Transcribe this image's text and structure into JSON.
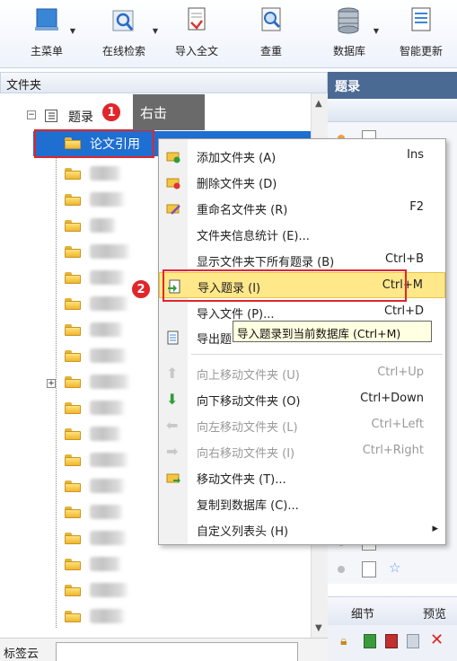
{
  "toolbar": {
    "items": [
      {
        "label": "主菜单",
        "icon": "main-menu-icon"
      },
      {
        "label": "在线检索",
        "icon": "online-search-icon"
      },
      {
        "label": "导入全文",
        "icon": "import-fulltext-icon"
      },
      {
        "label": "查重",
        "icon": "duplicate-check-icon"
      },
      {
        "label": "数据库",
        "icon": "database-icon"
      },
      {
        "label": "智能更新",
        "icon": "smart-update-icon"
      }
    ]
  },
  "left_panel": {
    "header": "文件夹",
    "tree_parent": "题录",
    "selected_folder": "论文引用"
  },
  "annotations": {
    "step1_badge": "1",
    "step1_text": "右击",
    "step2_badge": "2"
  },
  "right_panel": {
    "header": "题录",
    "tabs": [
      "细节",
      "预览"
    ]
  },
  "bottom": {
    "label": "标签云"
  },
  "context_menu": {
    "items": [
      {
        "label": "添加文件夹 (A)",
        "shortcut": "Ins",
        "enabled": true
      },
      {
        "label": "删除文件夹 (D)",
        "shortcut": "",
        "enabled": true
      },
      {
        "label": "重命名文件夹 (R)",
        "shortcut": "F2",
        "enabled": true
      },
      {
        "label": "文件夹信息统计 (E)...",
        "shortcut": "",
        "enabled": true
      },
      {
        "label": "显示文件夹下所有题录 (B)",
        "shortcut": "Ctrl+B",
        "enabled": true
      },
      {
        "label": "导入题录 (I)",
        "shortcut": "Ctrl+M",
        "enabled": true,
        "highlighted": true
      },
      {
        "label": "导入文件 (P)...",
        "shortcut": "Ctrl+D",
        "enabled": true
      },
      {
        "label": "导出题",
        "shortcut": "",
        "enabled": true
      },
      {
        "label": "向上移动文件夹 (U)",
        "shortcut": "Ctrl+Up",
        "enabled": false
      },
      {
        "label": "向下移动文件夹 (O)",
        "shortcut": "Ctrl+Down",
        "enabled": true
      },
      {
        "label": "向左移动文件夹 (L)",
        "shortcut": "Ctrl+Left",
        "enabled": false
      },
      {
        "label": "向右移动文件夹 (I)",
        "shortcut": "Ctrl+Right",
        "enabled": false
      },
      {
        "label": "移动文件夹 (T)...",
        "shortcut": "",
        "enabled": true
      },
      {
        "label": "复制到数据库 (C)...",
        "shortcut": "",
        "enabled": true
      },
      {
        "label": "自定义列表头 (H)",
        "shortcut": "▸",
        "enabled": true
      }
    ],
    "tooltip": "导入题录到当前数据库 (Ctrl+M)"
  },
  "colors": {
    "selection": "#1e6fd1",
    "annotation_red": "#e0262b",
    "menu_highlight": "#ffe88a",
    "right_header": "#4a6a94"
  }
}
